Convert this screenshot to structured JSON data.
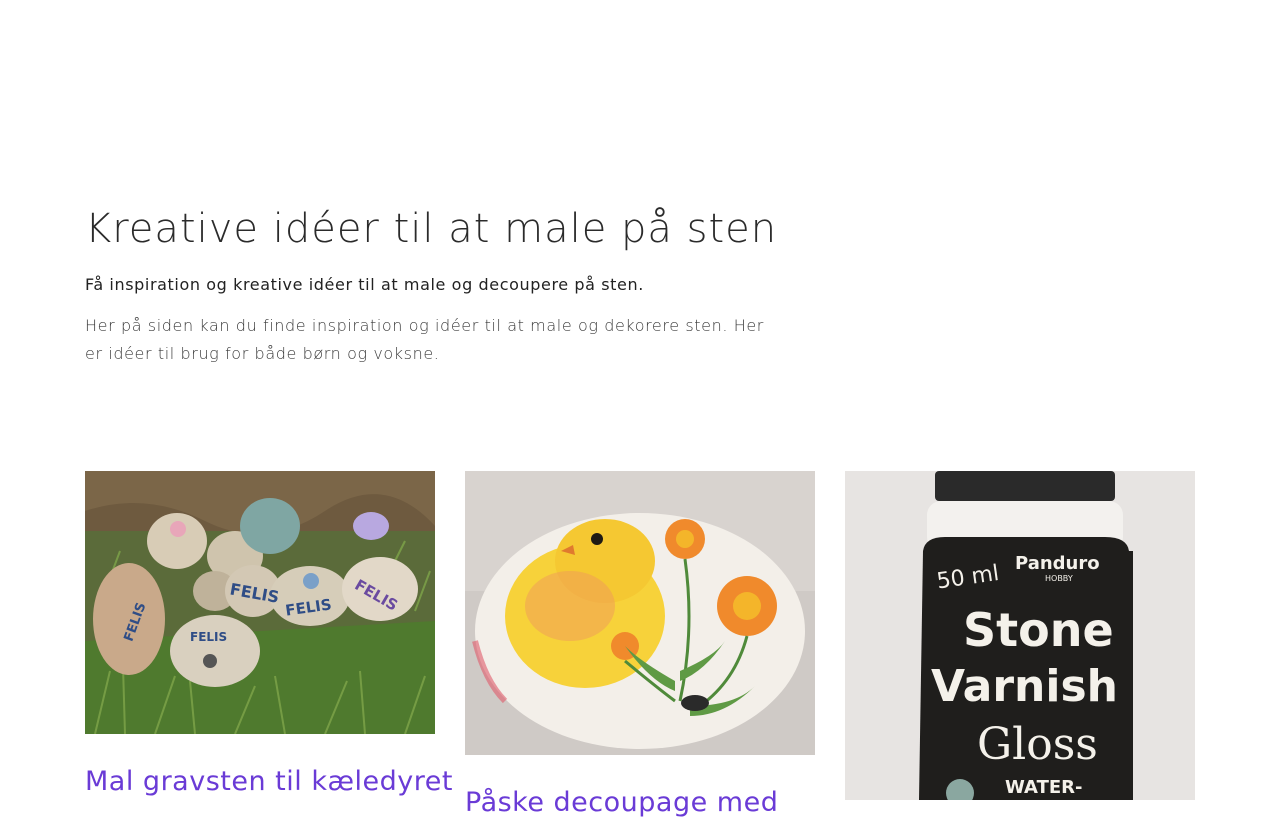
{
  "intro": {
    "title": "Kreative idéer til at male på sten",
    "lead": "Få inspiration og kreative idéer til at male og decoupere på sten.",
    "body": "Her på siden kan du finde inspiration og idéer til at male og dekorere sten. Her er idéer til brug for både børn og voksne."
  },
  "cards": [
    {
      "title": "Mal gravsten til kæledyret",
      "image_icon": "painted-stones-photo",
      "image_text": [
        "FELIS",
        "FELIS",
        "FELIS",
        "FELIS",
        "FELIS"
      ]
    },
    {
      "title": "Påske decoupage med",
      "image_icon": "decoupage-chick-stone-photo"
    },
    {
      "title": "",
      "image_icon": "stone-varnish-bottle-photo",
      "image_text": [
        "50 ml",
        "Panduro",
        "HOBBY",
        "Stone",
        "Varnish",
        "Gloss",
        "WATER-"
      ]
    }
  ],
  "colors": {
    "link": "#6a3bd6",
    "text": "#2b2b2b"
  }
}
